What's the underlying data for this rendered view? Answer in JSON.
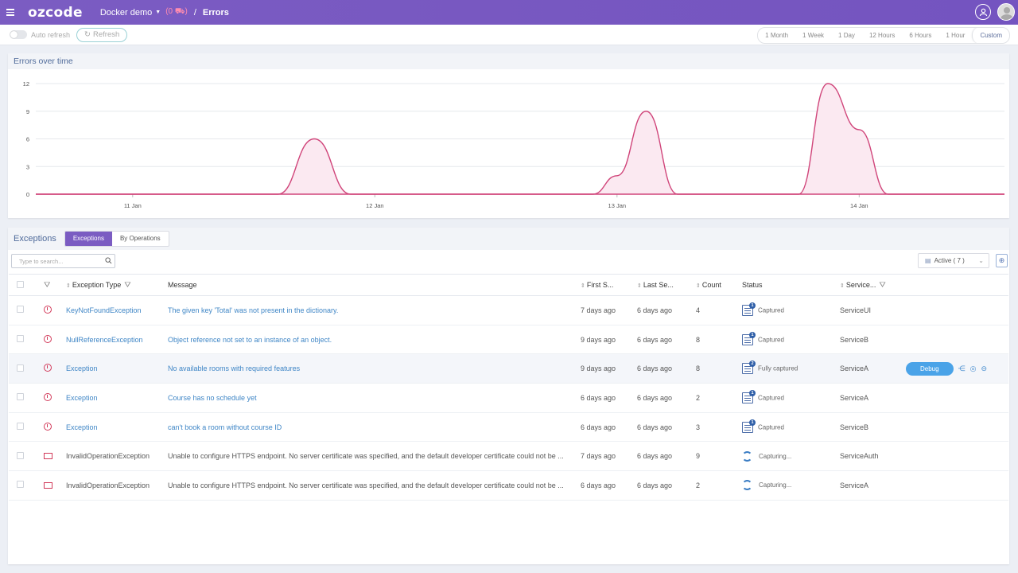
{
  "header": {
    "logo": "ozcode",
    "project": "Docker demo",
    "project_count": "(0",
    "project_count_end": ")",
    "separator": "/",
    "page": "Errors"
  },
  "toolbar": {
    "auto_refresh_label": "Auto refresh",
    "refresh_label": "Refresh",
    "ranges": [
      "1 Month",
      "1 Week",
      "1 Day",
      "12 Hours",
      "6 Hours",
      "1 Hour",
      "Custom"
    ],
    "active_range": "Custom"
  },
  "chart_panel": {
    "title": "Errors over time"
  },
  "chart_data": {
    "type": "area",
    "title": "Errors over time",
    "xlabel": "",
    "ylabel": "",
    "x_ticks": [
      "11 Jan",
      "12 Jan",
      "13 Jan",
      "14 Jan"
    ],
    "y_ticks": [
      0,
      3,
      6,
      9,
      12
    ],
    "ylim": [
      0,
      12
    ],
    "grid": true,
    "series": [
      {
        "x": [
          10.6,
          11.6,
          11.75,
          11.9,
          12.0,
          12.5,
          12.9,
          13.0,
          13.12,
          13.25,
          13.4,
          13.5,
          13.75,
          13.87,
          14.0,
          14.12,
          14.25,
          14.5,
          14.6
        ],
        "values": [
          0,
          0,
          6,
          0,
          0,
          0,
          0,
          2,
          9,
          0,
          0,
          0,
          0,
          12,
          7,
          0,
          0,
          0,
          0
        ]
      }
    ],
    "color": "#d0457a"
  },
  "exceptions": {
    "title": "Exceptions",
    "tabs": [
      "Exceptions",
      "By Operations"
    ],
    "search_placeholder": "Type to search...",
    "active_filter": "Active ( 7 )",
    "columns": [
      "Exception Type",
      "Message",
      "First S...",
      "Last Se...",
      "Count",
      "Status",
      "Service..."
    ],
    "debug_label": "Debug",
    "rows": [
      {
        "type": "KeyNotFoundException",
        "message": "The given key 'Total' was not present in the dictionary.",
        "first": "7 days ago",
        "last": "6 days ago",
        "count": "4",
        "status": "Captured",
        "badge": "1",
        "service": "ServiceUI",
        "link": true
      },
      {
        "type": "NullReferenceException",
        "message": "Object reference not set to an instance of an object.",
        "first": "9 days ago",
        "last": "6 days ago",
        "count": "8",
        "status": "Captured",
        "badge": "1",
        "service": "ServiceB",
        "link": true
      },
      {
        "type": "Exception",
        "message": "No available rooms with required features",
        "first": "9 days ago",
        "last": "6 days ago",
        "count": "8",
        "status": "Fully captured",
        "badge": "2",
        "service": "ServiceA",
        "link": true
      },
      {
        "type": "Exception",
        "message": "Course has no schedule yet",
        "first": "6 days ago",
        "last": "6 days ago",
        "count": "2",
        "status": "Captured",
        "badge": "1",
        "service": "ServiceA",
        "link": true
      },
      {
        "type": "Exception",
        "message": "can't book a room without course ID",
        "first": "6 days ago",
        "last": "6 days ago",
        "count": "3",
        "status": "Captured",
        "badge": "1",
        "service": "ServiceB",
        "link": true
      },
      {
        "type": "InvalidOperationException",
        "message": "Unable to configure HTTPS endpoint. No server certificate was specified, and the default developer certificate could not be ...",
        "first": "7 days ago",
        "last": "6 days ago",
        "count": "9",
        "status": "Capturing...",
        "badge": "",
        "service": "ServiceAuth",
        "link": false
      },
      {
        "type": "InvalidOperationException",
        "message": "Unable to configure HTTPS endpoint. No server certificate was specified, and the default developer certificate could not be ...",
        "first": "6 days ago",
        "last": "6 days ago",
        "count": "2",
        "status": "Capturing...",
        "badge": "",
        "service": "ServiceA",
        "link": false
      }
    ]
  }
}
